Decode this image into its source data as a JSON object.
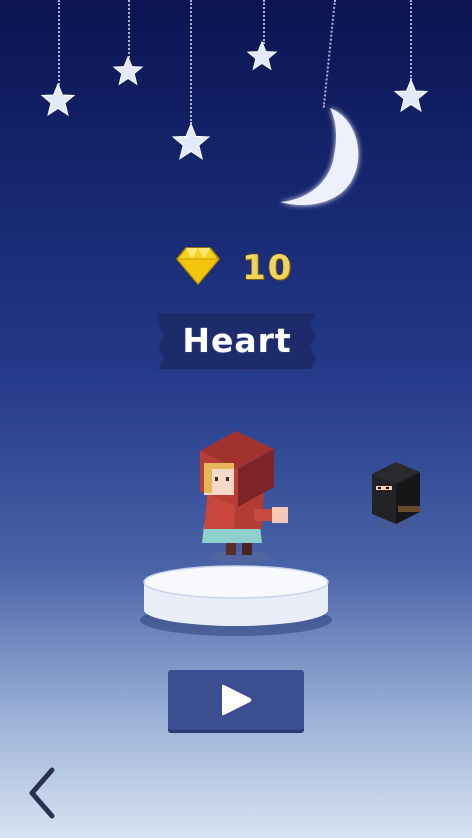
{
  "hud": {
    "gem_icon": "diamond-icon",
    "gem_count": "10"
  },
  "character": {
    "name": "Heart"
  },
  "controls": {
    "play_icon": "play-icon",
    "back_icon": "chevron-left-icon"
  },
  "colors": {
    "sky_top": "#0b1450",
    "sky_bottom": "#d8e3f2",
    "gem_count": "#f2d45a",
    "banner": "#1e2b6a",
    "play_button": "#3b4e91"
  }
}
